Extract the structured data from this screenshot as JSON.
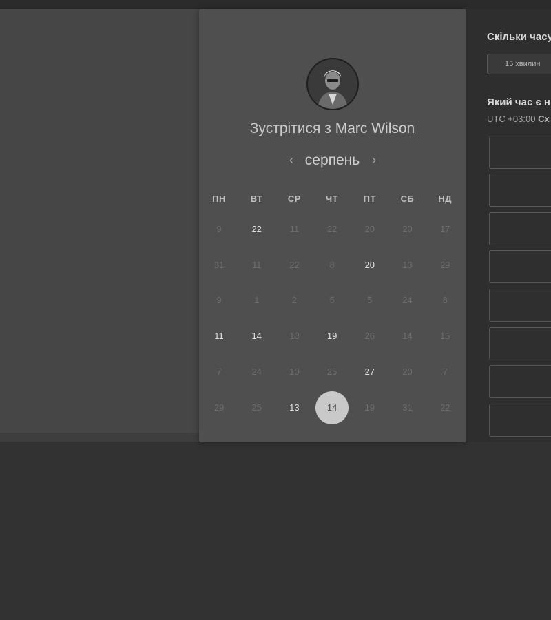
{
  "meeting": {
    "title_prefix": "Зустрітися з",
    "host_name": "Marc Wilson"
  },
  "calendar": {
    "month": "серпень",
    "prev_icon": "chevron-left-icon",
    "next_icon": "chevron-right-icon",
    "weekdays": [
      "ПН",
      "ВТ",
      "СР",
      "ЧТ",
      "ПТ",
      "СБ",
      "НД"
    ],
    "weeks": [
      [
        {
          "d": "9",
          "a": false
        },
        {
          "d": "22",
          "a": true
        },
        {
          "d": "11",
          "a": false
        },
        {
          "d": "22",
          "a": false
        },
        {
          "d": "20",
          "a": false
        },
        {
          "d": "20",
          "a": false
        },
        {
          "d": "17",
          "a": false
        }
      ],
      [
        {
          "d": "31",
          "a": false
        },
        {
          "d": "11",
          "a": false
        },
        {
          "d": "22",
          "a": false
        },
        {
          "d": "8",
          "a": false
        },
        {
          "d": "20",
          "a": true
        },
        {
          "d": "13",
          "a": false
        },
        {
          "d": "29",
          "a": false
        }
      ],
      [
        {
          "d": "9",
          "a": false
        },
        {
          "d": "1",
          "a": false
        },
        {
          "d": "2",
          "a": false
        },
        {
          "d": "5",
          "a": false
        },
        {
          "d": "5",
          "a": false
        },
        {
          "d": "24",
          "a": false
        },
        {
          "d": "8",
          "a": false
        }
      ],
      [
        {
          "d": "11",
          "a": true
        },
        {
          "d": "14",
          "a": true
        },
        {
          "d": "10",
          "a": false
        },
        {
          "d": "19",
          "a": true
        },
        {
          "d": "26",
          "a": false
        },
        {
          "d": "14",
          "a": false
        },
        {
          "d": "15",
          "a": false
        }
      ],
      [
        {
          "d": "7",
          "a": false
        },
        {
          "d": "24",
          "a": false
        },
        {
          "d": "10",
          "a": false
        },
        {
          "d": "25",
          "a": false
        },
        {
          "d": "27",
          "a": true
        },
        {
          "d": "20",
          "a": false
        },
        {
          "d": "7",
          "a": false
        }
      ],
      [
        {
          "d": "29",
          "a": false
        },
        {
          "d": "25",
          "a": false
        },
        {
          "d": "13",
          "a": true
        },
        {
          "d": "14",
          "a": true,
          "selected": true
        },
        {
          "d": "19",
          "a": false
        },
        {
          "d": "31",
          "a": false
        },
        {
          "d": "22",
          "a": false
        }
      ]
    ]
  },
  "scheduler": {
    "duration_title": "Скільки часу",
    "duration_value": "15 хвилин",
    "time_title": "Який час є н",
    "timezone_prefix": "UTC +03:00",
    "timezone_name": "Сх"
  },
  "colors": {
    "panel_bg": "#4f4f4f",
    "right_panel_bg": "#2e2e2e",
    "selected_day": "#c9c9c9"
  }
}
